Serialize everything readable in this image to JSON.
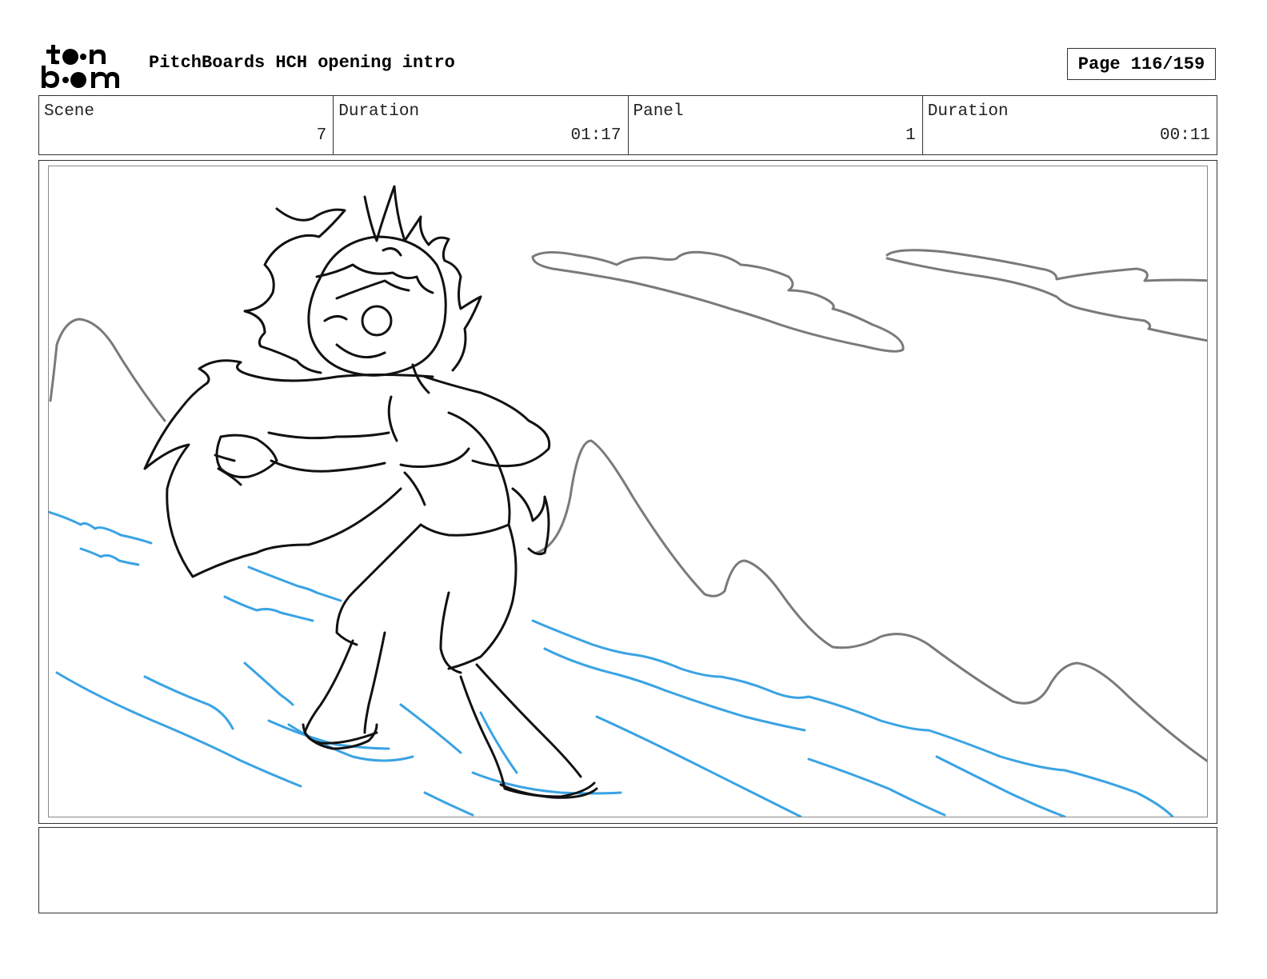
{
  "header": {
    "logo_line1": "t●n",
    "logo_line2": "b●●m",
    "logo_brand": "toon boom",
    "title": "PitchBoards HCH opening intro",
    "page_label": "Page 116/159"
  },
  "info": {
    "scene_label": "Scene",
    "scene_value": "7",
    "scene_duration_label": "Duration",
    "scene_duration_value": "01:17",
    "panel_label": "Panel",
    "panel_value": "1",
    "panel_duration_label": "Duration",
    "panel_duration_value": "00:11"
  },
  "panel": {
    "sketch_subject": "character-on-beach-sketch",
    "colors": {
      "character": "#111111",
      "mountains": "#7a7a7a",
      "clouds": "#7a7a7a",
      "water": "#3aa3e3"
    }
  },
  "notes": {
    "text": ""
  }
}
